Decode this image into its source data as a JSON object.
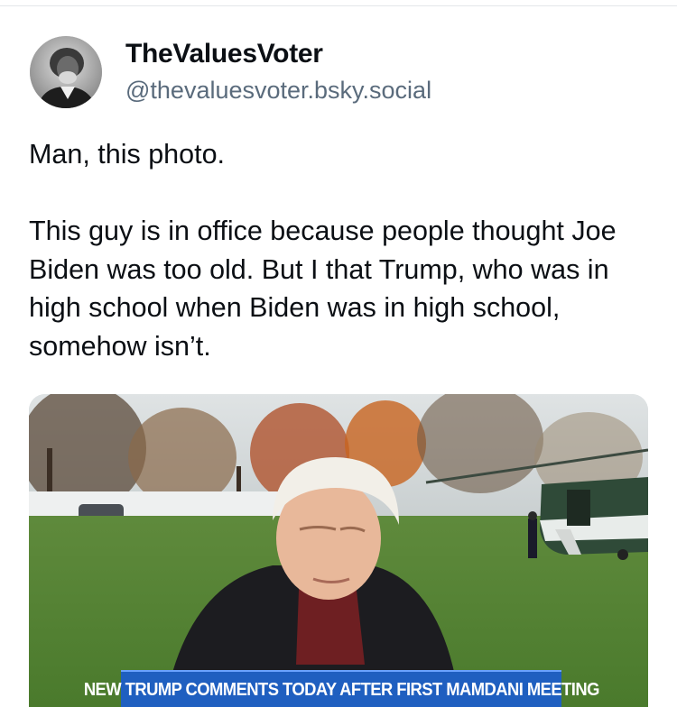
{
  "post": {
    "author": {
      "display_name": "TheValuesVoter",
      "handle": "@thevaluesvoter.bsky.social"
    },
    "text": [
      "Man, this photo.",
      "This guy is in office because people thought Joe Biden was too old. But I that Trump, who was in high school when Biden was in high school, somehow isn’t."
    ],
    "media": {
      "chyron": "NEW TRUMP COMMENTS TODAY AFTER FIRST MAMDANI MEETING"
    }
  }
}
